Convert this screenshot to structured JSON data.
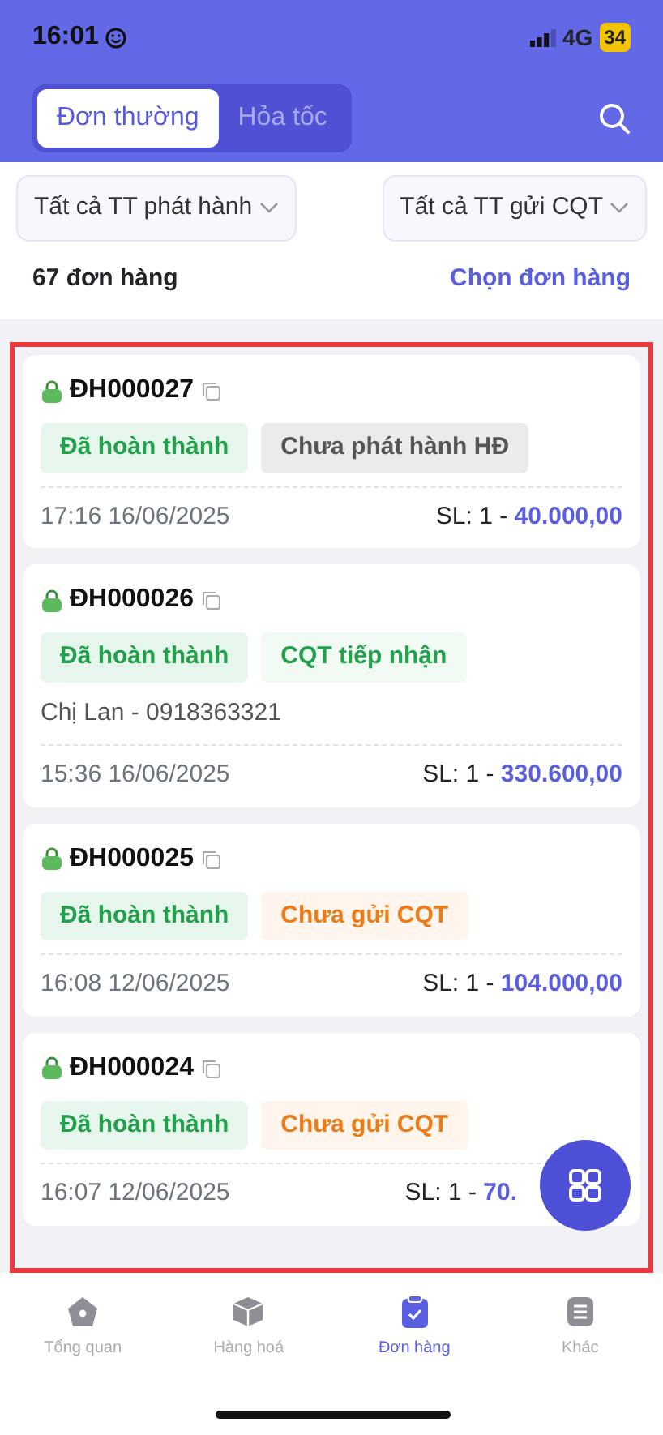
{
  "status_bar": {
    "time": "16:01",
    "network": "4G",
    "battery": "34"
  },
  "tabs": [
    {
      "label": "Đơn thường",
      "selected": true
    },
    {
      "label": "Hỏa tốc",
      "selected": false
    }
  ],
  "filters": [
    {
      "label": "Tất cả TT phát hành"
    },
    {
      "label": "Tất cả TT gửi CQT"
    }
  ],
  "summary": {
    "count": "67 đơn hàng",
    "action": "Chọn đơn hàng"
  },
  "orders": [
    {
      "code": "ĐH000027",
      "tags": [
        {
          "label": "Đã hoàn thành",
          "kind": "success"
        },
        {
          "label": "Chưa phát hành HĐ",
          "kind": "neutral"
        }
      ],
      "time": "17:16 16/06/2025",
      "quantity": "SL: 1 -",
      "amount": "40.000,00"
    },
    {
      "code": "ĐH000026",
      "tags": [
        {
          "label": "Đã hoàn thành",
          "kind": "success"
        },
        {
          "label": "CQT tiếp nhận",
          "kind": "accepted"
        }
      ],
      "customer": "Chị Lan - 0918363321",
      "time": "15:36 16/06/2025",
      "quantity": "SL: 1 -",
      "amount": "330.600,00"
    },
    {
      "code": "ĐH000025",
      "tags": [
        {
          "label": "Đã hoàn thành",
          "kind": "success"
        },
        {
          "label": "Chưa gửi CQT",
          "kind": "warning"
        }
      ],
      "time": "16:08 12/06/2025",
      "quantity": "SL: 1 -",
      "amount": "104.000,00"
    },
    {
      "code": "ĐH000024",
      "tags": [
        {
          "label": "Đã hoàn thành",
          "kind": "success"
        },
        {
          "label": "Chưa gửi CQT",
          "kind": "warning"
        }
      ],
      "time": "16:07 12/06/2025",
      "quantity": "SL: 1 -",
      "amount": "70."
    }
  ],
  "bottom_nav": [
    {
      "label": "Tổng quan",
      "kind": "home",
      "selected": false
    },
    {
      "label": "Hàng hoá",
      "kind": "box",
      "selected": false
    },
    {
      "label": "Đơn hàng",
      "kind": "clipboard",
      "selected": true
    },
    {
      "label": "Khác",
      "kind": "menu",
      "selected": false
    }
  ]
}
